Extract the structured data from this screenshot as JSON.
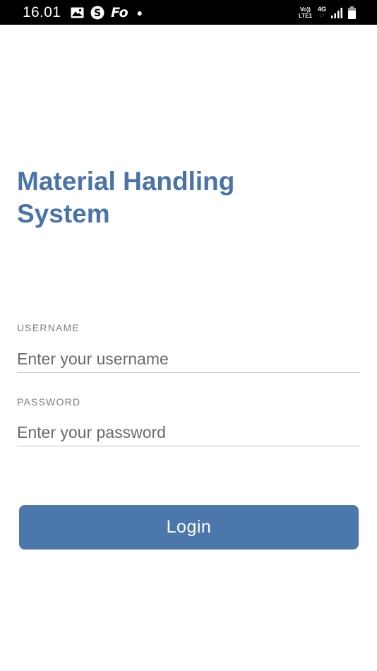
{
  "status_bar": {
    "time": "16.01",
    "app_icons": [
      "gallery-icon",
      "skype-icon",
      "fo-app-icon"
    ],
    "fo_label": "Fo",
    "network_volte_top": "Vo))",
    "network_volte_bottom": "LTE1",
    "network_type": "4G",
    "network_arrows": "↓↑",
    "signal_icon": "signal-bars-icon",
    "battery_icon": "battery-icon"
  },
  "login": {
    "title": "Material Handling System",
    "username_label": "USERNAME",
    "username_placeholder": "Enter your username",
    "password_label": "PASSWORD",
    "password_placeholder": "Enter your password",
    "button_label": "Login"
  },
  "colors": {
    "accent": "#4a74a8",
    "button": "#4c77ad",
    "status_bar": "#000000"
  }
}
